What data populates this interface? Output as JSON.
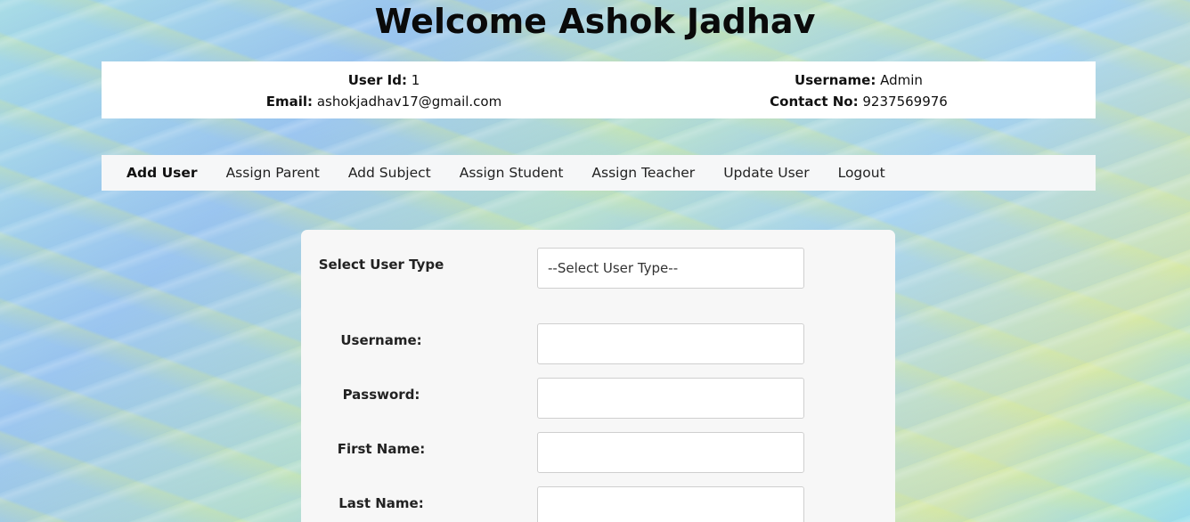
{
  "header": {
    "title": "Welcome Ashok Jadhav"
  },
  "user_info": {
    "user_id_label": "User Id:",
    "user_id_value": "1",
    "email_label": "Email:",
    "email_value": "ashokjadhav17@gmail.com",
    "username_label": "Username:",
    "username_value": "Admin",
    "contact_label": "Contact No:",
    "contact_value": "9237569976"
  },
  "nav": {
    "items": [
      {
        "label": "Add User",
        "active": true
      },
      {
        "label": "Assign Parent"
      },
      {
        "label": "Add Subject"
      },
      {
        "label": "Assign Student"
      },
      {
        "label": "Assign Teacher"
      },
      {
        "label": "Update User"
      },
      {
        "label": "Logout"
      }
    ]
  },
  "form": {
    "user_type_label": "Select User Type",
    "user_type_selected": "--Select User Type--",
    "username_label": "Username:",
    "username_value": "",
    "password_label": "Password:",
    "password_value": "",
    "first_name_label": "First Name:",
    "first_name_value": "",
    "last_name_label": "Last Name:",
    "last_name_value": ""
  }
}
